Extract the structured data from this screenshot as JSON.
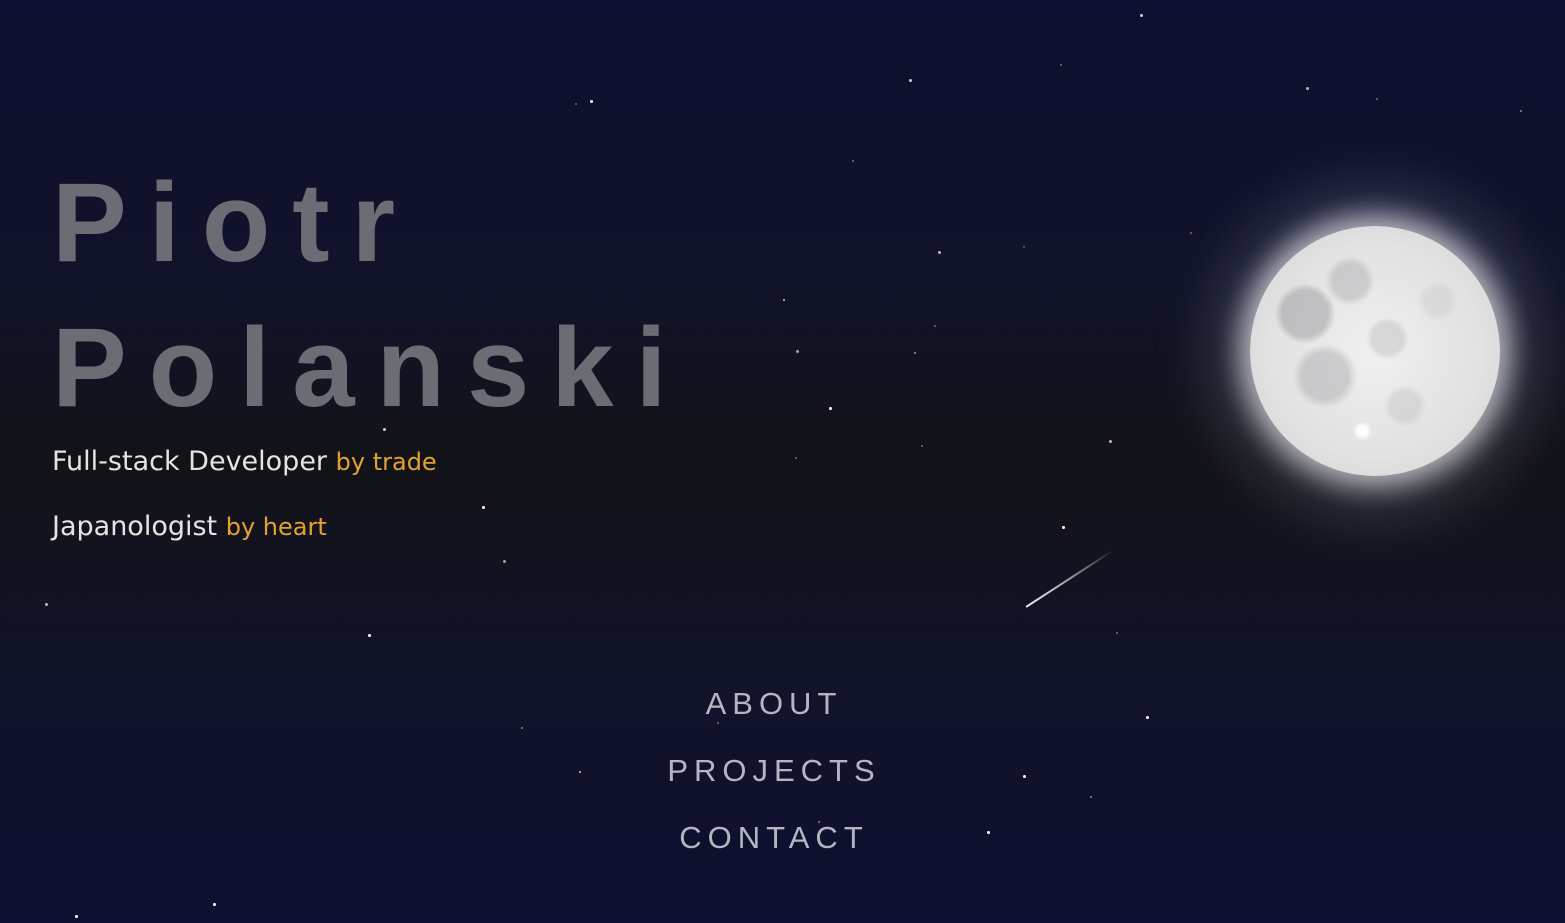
{
  "hero": {
    "first_name": "Piotr",
    "last_name": "Polanski"
  },
  "taglines": [
    {
      "main": "Full-stack Developer",
      "accent": "by trade"
    },
    {
      "main": "Japanologist",
      "accent": "by heart"
    }
  ],
  "nav": {
    "items": [
      {
        "label": "ABOUT"
      },
      {
        "label": "PROJECTS"
      },
      {
        "label": "CONTACT"
      }
    ]
  },
  "colors": {
    "name_text": "#6c6c75",
    "accent": "#e5a130",
    "nav_text": "#b5b5c2",
    "background_top": "#0d1030",
    "background_mid": "#121318"
  }
}
